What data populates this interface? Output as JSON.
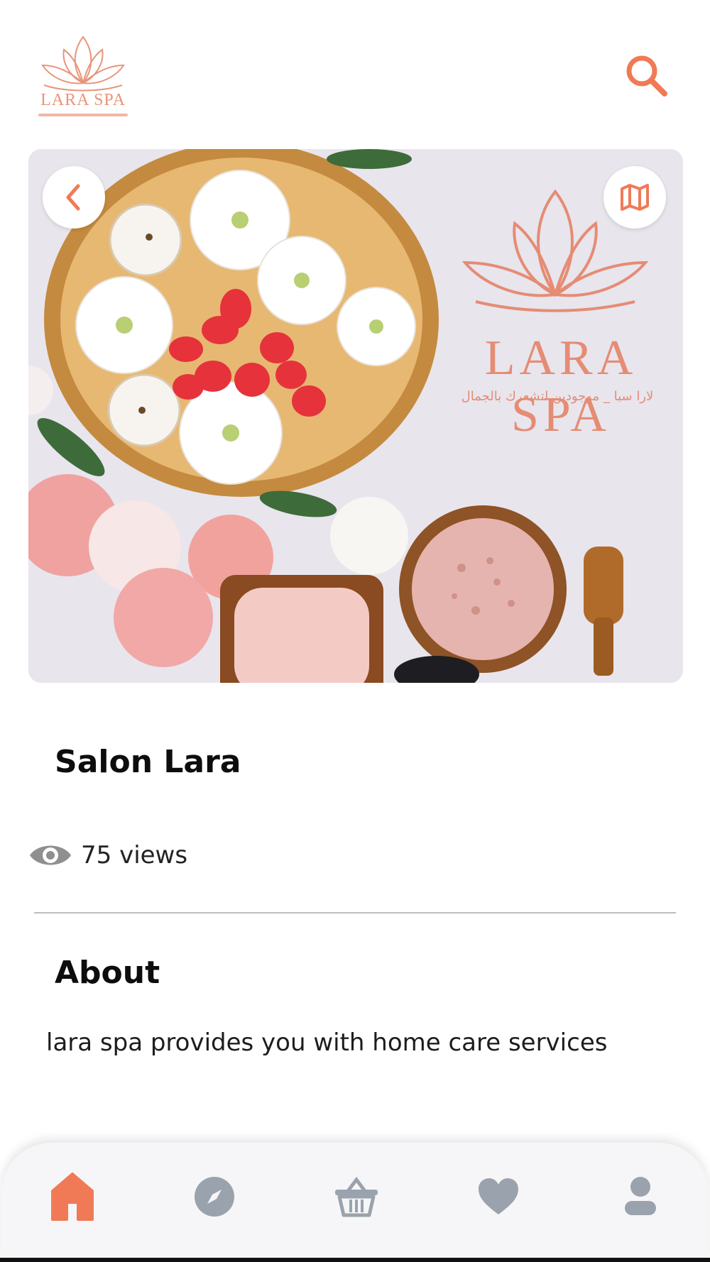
{
  "header": {
    "logo_text": "LARA SPA",
    "search_icon": "search-icon",
    "accent_color": "#f07a56"
  },
  "hero": {
    "brand_text": "LARA SPA",
    "tagline": "لارا سبا _ موجودين لتشعرك بالجمال",
    "back_icon": "chevron-left-icon",
    "map_icon": "map-icon"
  },
  "salon": {
    "name": "Salon Lara",
    "views": "75 views"
  },
  "about": {
    "title": "About",
    "text": "lara spa provides you with home care services"
  },
  "nav": {
    "items": [
      {
        "name": "home",
        "icon": "home-icon",
        "active": true
      },
      {
        "name": "explore",
        "icon": "compass-icon",
        "active": false
      },
      {
        "name": "cart",
        "icon": "basket-icon",
        "active": false
      },
      {
        "name": "favorites",
        "icon": "heart-icon",
        "active": false
      },
      {
        "name": "profile",
        "icon": "user-icon",
        "active": false
      }
    ],
    "active_color": "#f07a56",
    "inactive_color": "#9aa3ad"
  }
}
